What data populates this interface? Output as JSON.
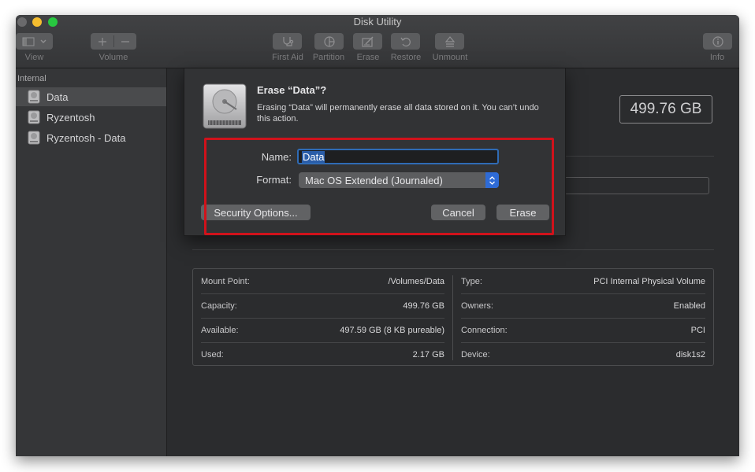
{
  "window": {
    "title": "Disk Utility"
  },
  "toolbar": {
    "view_label": "View",
    "volume_label": "Volume",
    "first_aid_label": "First Aid",
    "partition_label": "Partition",
    "erase_label": "Erase",
    "restore_label": "Restore",
    "unmount_label": "Unmount",
    "info_label": "Info"
  },
  "sidebar": {
    "header": "Internal",
    "items": [
      {
        "label": "Data",
        "selected": true
      },
      {
        "label": "Ryzentosh",
        "selected": false
      },
      {
        "label": "Ryzentosh - Data",
        "selected": false
      }
    ]
  },
  "volume": {
    "capacity_display": "499.76 GB"
  },
  "info_table": {
    "left": [
      {
        "key": "Mount Point:",
        "value": "/Volumes/Data"
      },
      {
        "key": "Capacity:",
        "value": "499.76 GB"
      },
      {
        "key": "Available:",
        "value": "497.59 GB (8 KB pureable)"
      },
      {
        "key": "Used:",
        "value": "2.17 GB"
      }
    ],
    "right": [
      {
        "key": "Type:",
        "value": "PCI Internal Physical Volume"
      },
      {
        "key": "Owners:",
        "value": "Enabled"
      },
      {
        "key": "Connection:",
        "value": "PCI"
      },
      {
        "key": "Device:",
        "value": "disk1s2"
      }
    ]
  },
  "erase_sheet": {
    "title": "Erase “Data”?",
    "message": "Erasing “Data” will permanently erase all data stored on it. You can’t undo this action.",
    "name_label": "Name:",
    "name_value": "Data",
    "format_label": "Format:",
    "format_value": "Mac OS Extended (Journaled)",
    "security_options_label": "Security Options...",
    "cancel_label": "Cancel",
    "erase_label": "Erase"
  },
  "colors": {
    "highlight": "#d0121b",
    "accent": "#2e6bd6",
    "window_bg": "#2b2c2e",
    "sidebar_bg": "#353638"
  },
  "icons": [
    "sidebar-toggle-icon",
    "chevron-down-icon",
    "plus-icon",
    "minus-icon",
    "stethoscope-icon",
    "pie-chart-icon",
    "erase-icon",
    "restore-icon",
    "unmount-icon",
    "info-icon",
    "hard-disk-icon"
  ]
}
